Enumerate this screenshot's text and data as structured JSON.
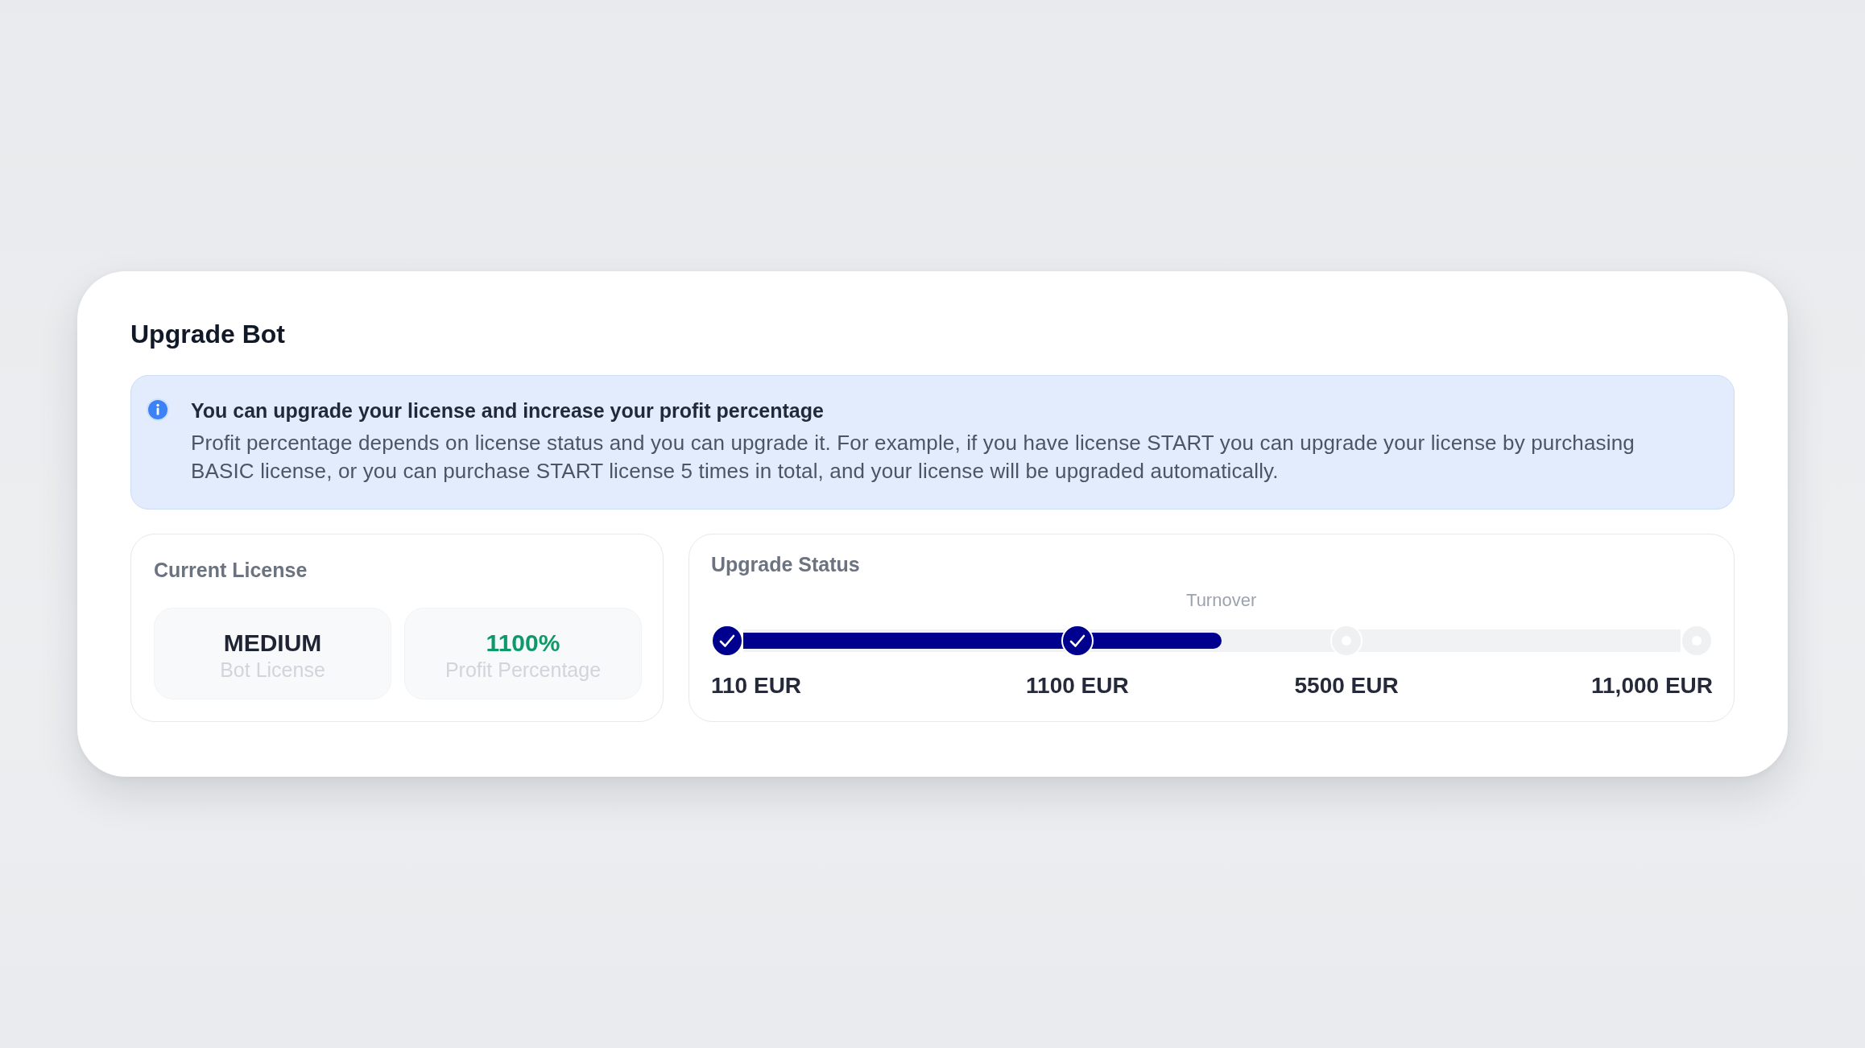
{
  "title": "Upgrade Bot",
  "info": {
    "heading": "You can upgrade your license and increase your profit percentage",
    "body": "Profit percentage depends on license status and you can upgrade it. For example, if you have license START you can upgrade your license by purchasing BASIC license, or you can purchase START license 5 times in total, and your license will be upgraded automatically."
  },
  "current_license": {
    "title": "Current License",
    "tiles": [
      {
        "kind": "license",
        "value": "MEDIUM",
        "label": "Bot License"
      },
      {
        "kind": "percentage",
        "value": "1100%",
        "label": "Profit Percentage"
      }
    ]
  },
  "upgrade_status": {
    "title": "Upgrade Status",
    "marker_label": "Turnover",
    "progress": {
      "level": 0.51
    },
    "milestones": [
      {
        "label": "110 EUR",
        "reached": true
      },
      {
        "label": "1100 EUR",
        "reached": true
      },
      {
        "label": "5500 EUR",
        "reached": false
      },
      {
        "label": "11,000 EUR",
        "reached": false
      }
    ]
  }
}
